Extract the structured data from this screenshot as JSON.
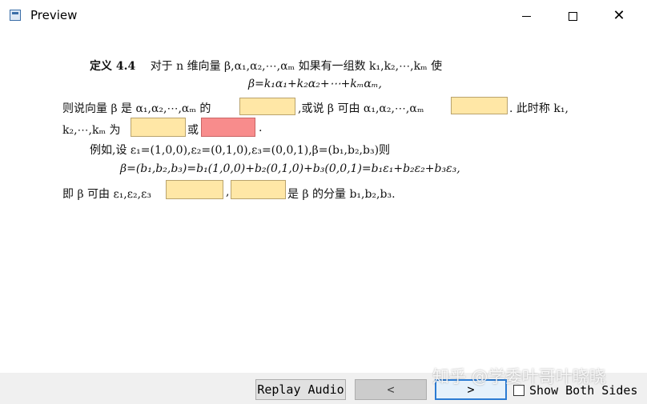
{
  "window": {
    "title": "Preview",
    "icons": {
      "app": "window-icon",
      "minimize": "minimize-icon",
      "maximize": "maximize-icon",
      "close": "close-icon"
    }
  },
  "document": {
    "line1_heading": "定义 4.4",
    "line1_text": "对于 n 维向量 β,α₁,α₂,⋯,αₘ 如果有一组数 k₁,k₂,⋯,kₘ 使",
    "line2_formula": "β=k₁α₁+k₂α₂+⋯+kₘαₘ,",
    "line3_a": "则说向量 β 是 α₁,α₂,⋯,αₘ 的",
    "line3_b": ",或说 β 可由 α₁,α₂,⋯,αₘ",
    "line3_c": ". 此时称 k₁,",
    "line4_a": "k₂,⋯,kₘ 为",
    "line4_b": "或",
    "line4_c": ".",
    "line5": "例如,设 ε₁=(1,0,0),ε₂=(0,1,0),ε₃=(0,0,1),β=(b₁,b₂,b₃)则",
    "line6_formula": "β=(b₁,b₂,b₃)=b₁(1,0,0)+b₂(0,1,0)+b₃(0,0,1)=b₁ε₁+b₂ε₂+b₃ε₃,",
    "line7_a": "即 β 可由 ε₁,ε₂,ε₃",
    "line7_b": ",",
    "line7_c": "是 β 的分量 b₁,b₂,b₃.",
    "blank_colors": {
      "yellow": "#ffe7a6",
      "red": "#f88c8c"
    }
  },
  "toolbar": {
    "replay_label": "Replay Audio",
    "prev_label": "<",
    "next_label": ">",
    "show_both_sides_label": "Show Both Sides",
    "show_both_sides_checked": false
  },
  "watermark": "知乎 @学委叶哥叶晓晓"
}
